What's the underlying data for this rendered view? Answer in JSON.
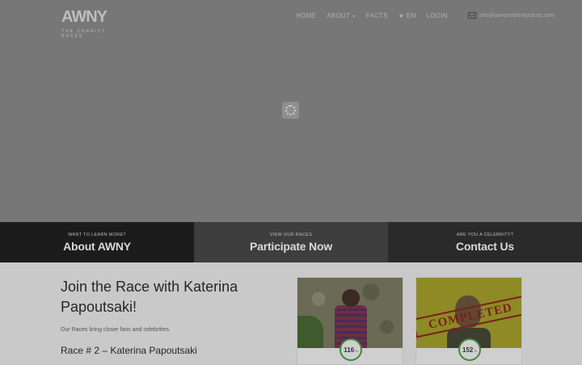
{
  "header": {
    "logo_text": "AWNY",
    "logo_tagline": "THE CHARITY RACES",
    "nav": [
      {
        "label": "HOME"
      },
      {
        "label": "ABOUT",
        "has_dropdown": true
      },
      {
        "label": "FACTS"
      },
      {
        "label": "★ EN"
      },
      {
        "label": "LOGIN"
      }
    ],
    "email": "info@awnycelebrityraces.com"
  },
  "tiles": [
    {
      "kicker": "WANT TO LEARN MORE?",
      "title": "About AWNY"
    },
    {
      "kicker": "VIEW OUR RACES",
      "title": "Participate Now"
    },
    {
      "kicker": "ARE YOU A CELEBRITY?",
      "title": "Contact Us"
    }
  ],
  "main": {
    "title": "Join the Race with Katerina Papoutsaki!",
    "description": "Our Races bring closer fans and celebrities.",
    "race_heading": "Race # 2 – Katerina Papoutsaki"
  },
  "cards": [
    {
      "count": "116",
      "unit": "%",
      "completed": false
    },
    {
      "count": "152",
      "unit": "%",
      "completed": true,
      "stamp_text": "COMPLETED"
    }
  ],
  "colors": {
    "hero_overlay": "#777777",
    "badge_ring": "#3f8a3a",
    "stamp": "#7a1e1e"
  }
}
